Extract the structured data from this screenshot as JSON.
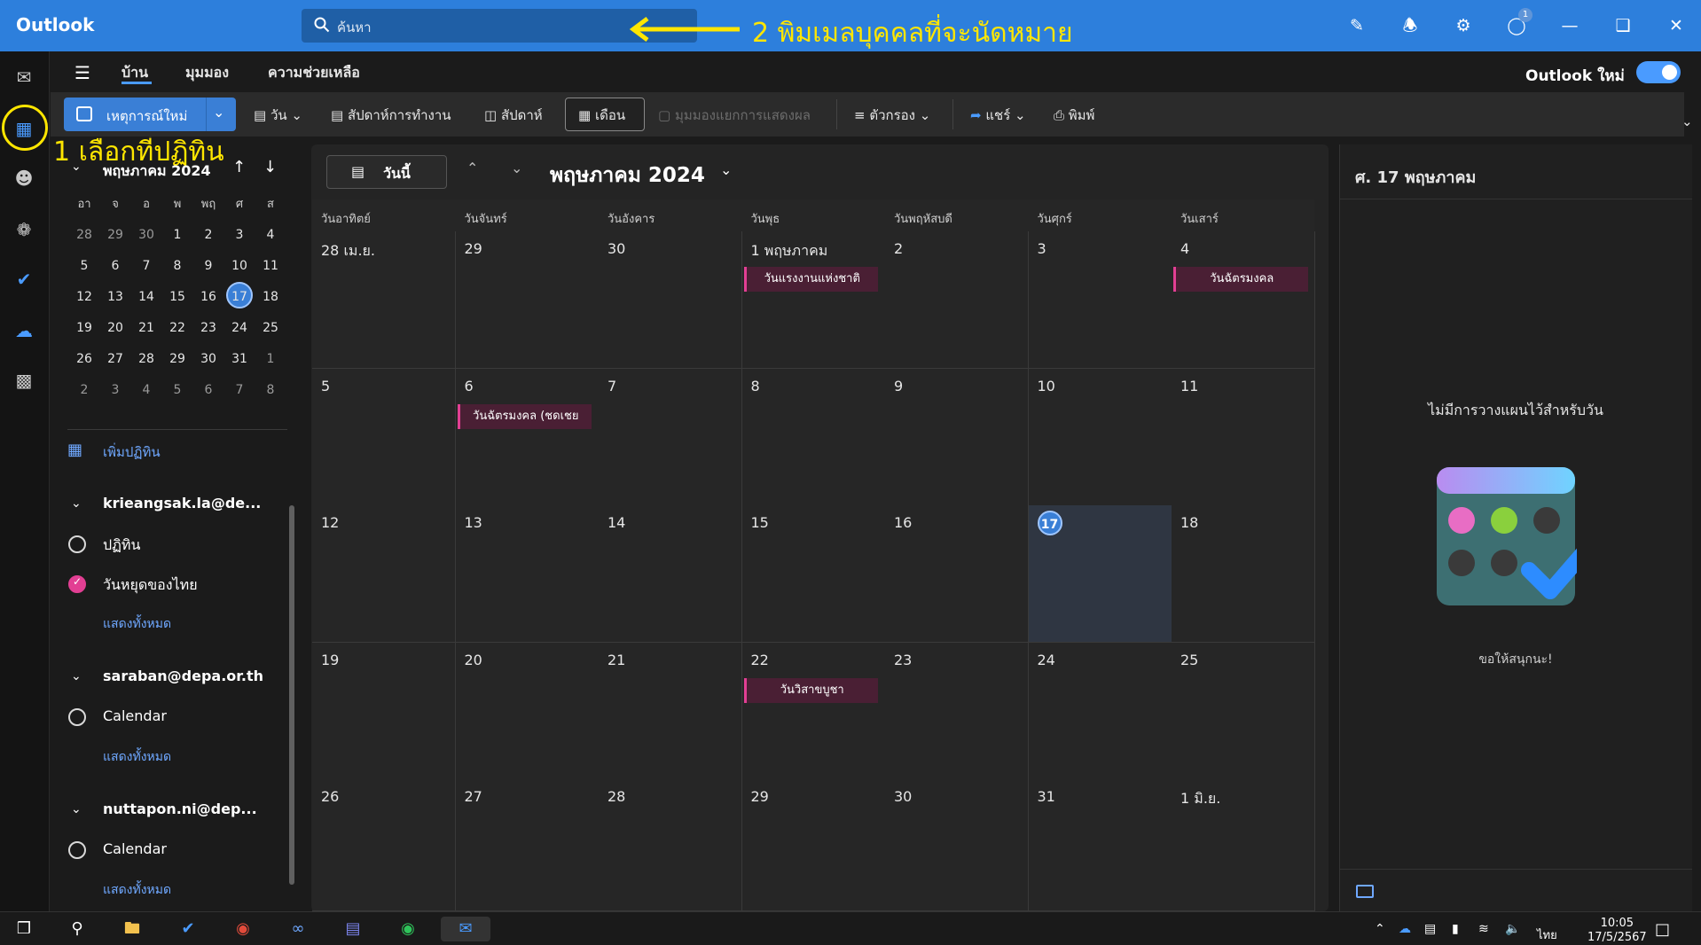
{
  "titlebar": {
    "app_title": "Outlook",
    "search_placeholder": "ค้นหา",
    "notif_badge": "1"
  },
  "annotations": {
    "step1": "1 เลือกที่ปฏิทิน",
    "step2": "2 พิมเมลบุคคลที่จะนัดหมาย",
    "color": "#ffe600"
  },
  "ribbon": {
    "tabs": [
      "บ้าน",
      "มุมมอง",
      "ความช่วยเหลือ"
    ],
    "new_outlook_label": "Outlook ใหม่",
    "new_event": "เหตุการณ์ใหม่",
    "tools": {
      "day": "วัน",
      "work_week": "สัปดาห์การทำงาน",
      "week": "สัปดาห์",
      "month": "เดือน",
      "split_view": "มุมมองแยกการแสดงผล",
      "filter": "ตัวกรอง",
      "share": "แชร์",
      "print": "พิมพ์"
    }
  },
  "mini_calendar": {
    "title": "พฤษภาคม 2024",
    "weekdays": [
      "อา",
      "จ",
      "อ",
      "พ",
      "พฤ",
      "ศ",
      "ส"
    ],
    "weeks": [
      [
        "28",
        "29",
        "30",
        "1",
        "2",
        "3",
        "4"
      ],
      [
        "5",
        "6",
        "7",
        "8",
        "9",
        "10",
        "11"
      ],
      [
        "12",
        "13",
        "14",
        "15",
        "16",
        "17",
        "18"
      ],
      [
        "19",
        "20",
        "21",
        "22",
        "23",
        "24",
        "25"
      ],
      [
        "26",
        "27",
        "28",
        "29",
        "30",
        "31",
        "1"
      ],
      [
        "2",
        "3",
        "4",
        "5",
        "6",
        "7",
        "8"
      ]
    ],
    "today": "17"
  },
  "sidebar": {
    "add_calendar": "เพิ่มปฏิทิน",
    "accounts": [
      {
        "name": "krieangsak.la@de...",
        "calendars": [
          {
            "label": "ปฏิทิน",
            "checked": false
          },
          {
            "label": "วันหยุดของไทย",
            "checked": true
          }
        ],
        "show_all": "แสดงทั้งหมด"
      },
      {
        "name": "saraban@depa.or.th",
        "calendars": [
          {
            "label": "Calendar",
            "checked": false
          }
        ],
        "show_all": "แสดงทั้งหมด"
      },
      {
        "name": "nuttapon.ni@dep...",
        "calendars": [
          {
            "label": "Calendar",
            "checked": false
          }
        ],
        "show_all": "แสดงทั้งหมด"
      }
    ]
  },
  "main": {
    "today_button": "วันนี้",
    "month_title": "พฤษภาคม 2024",
    "day_names": [
      "วันอาทิตย์",
      "วันจันทร์",
      "วันอังคาร",
      "วันพุธ",
      "วันพฤหัสบดี",
      "วันศุกร์",
      "วันเสาร์"
    ],
    "weeks": [
      [
        "28 เม.ย.",
        "29",
        "30",
        "1 พฤษภาคม",
        "2",
        "3",
        "4"
      ],
      [
        "5",
        "6",
        "7",
        "8",
        "9",
        "10",
        "11"
      ],
      [
        "12",
        "13",
        "14",
        "15",
        "16",
        "17",
        "18"
      ],
      [
        "19",
        "20",
        "21",
        "22",
        "23",
        "24",
        "25"
      ],
      [
        "26",
        "27",
        "28",
        "29",
        "30",
        "31",
        "1 มิ.ย."
      ]
    ],
    "today": "17",
    "events": [
      {
        "week": 0,
        "day": 3,
        "title": "วันแรงงานแห่งชาติ"
      },
      {
        "week": 0,
        "day": 6,
        "title": "วันฉัตรมงคล"
      },
      {
        "week": 1,
        "day": 1,
        "title": "วันฉัตรมงคล (ชดเชย"
      },
      {
        "week": 3,
        "day": 3,
        "title": "วันวิสาขบูชา"
      }
    ]
  },
  "right_panel": {
    "title": "ศ. 17 พฤษภาคม",
    "empty_message": "ไม่มีการวางแผนไว้สำหรับวัน",
    "footer": "ขอให้สนุกนะ!"
  },
  "taskbar": {
    "lang": "ไทย",
    "time": "10:05",
    "date": "17/5/2567"
  }
}
